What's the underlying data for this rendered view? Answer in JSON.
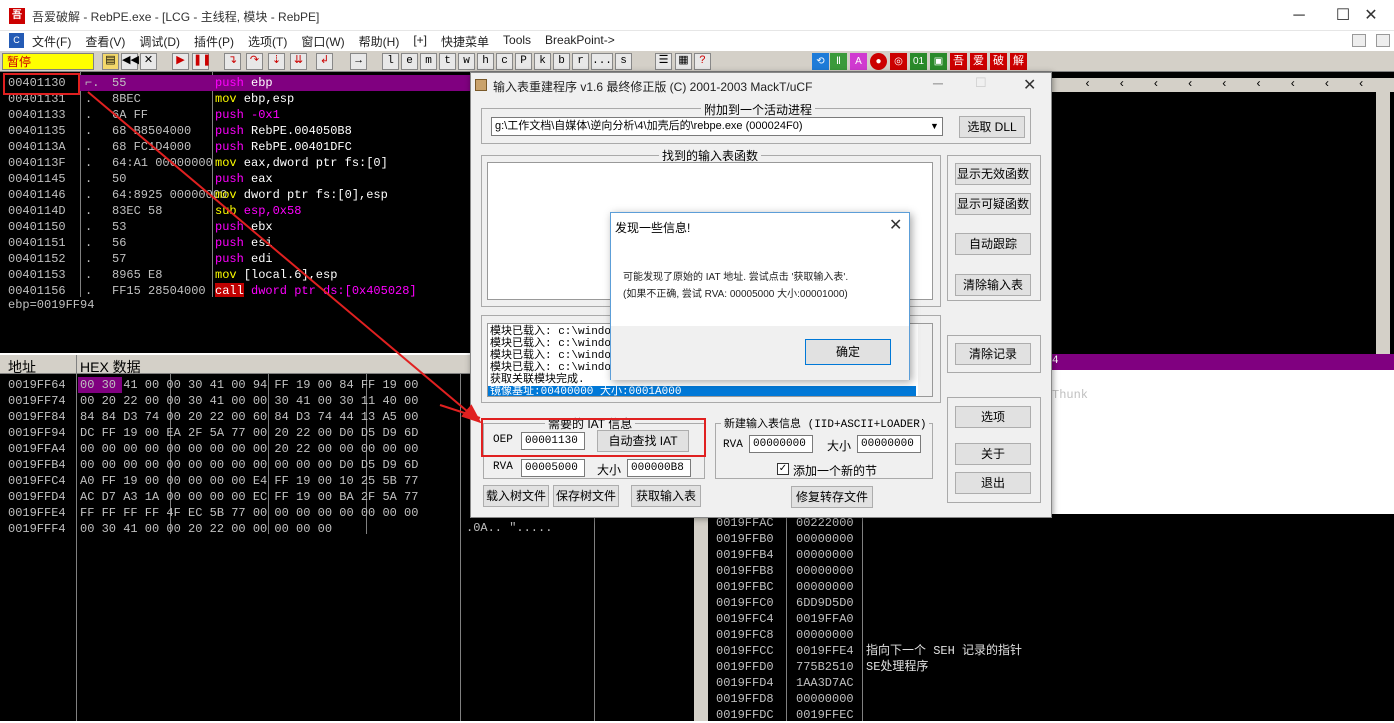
{
  "window": {
    "app_icon": "吾",
    "title": "吾爱破解 - RebPE.exe - [LCG -  主线程, 模块 - RebPE]",
    "min": "─",
    "max": "☐",
    "close": "✕"
  },
  "menu": {
    "icon": "C",
    "items": [
      "文件(F)",
      "查看(V)",
      "调试(D)",
      "插件(P)",
      "选项(T)",
      "窗口(W)",
      "帮助(H)",
      "[+]",
      "快捷菜单",
      "Tools",
      "BreakPoint->"
    ],
    "right_btns": [
      "▭",
      "▭"
    ]
  },
  "toolbar": {
    "status": "暂停",
    "letter_buttons": [
      "l",
      "e",
      "m",
      "t",
      "w",
      "h",
      "c",
      "P",
      "k",
      "b",
      "r",
      "...",
      "s"
    ],
    "right_buttons": [
      "吾",
      "爱",
      "破",
      "解"
    ]
  },
  "disasm": {
    "rows": [
      {
        "addr": "00401130",
        "dot": "⌐.",
        "hex": "55",
        "op": "push",
        "args": "ebp"
      },
      {
        "addr": "00401131",
        "dot": ".",
        "hex": "8BEC",
        "op": "mov",
        "args": "ebp,esp"
      },
      {
        "addr": "00401133",
        "dot": ".",
        "hex": "6A FF",
        "op": "push",
        "args": "-0x1"
      },
      {
        "addr": "00401135",
        "dot": ".",
        "hex": "68 B8504000",
        "op": "push",
        "args": "RebPE.004050B8"
      },
      {
        "addr": "0040113A",
        "dot": ".",
        "hex": "68 FC1D4000",
        "op": "push",
        "args": "RebPE.00401DFC"
      },
      {
        "addr": "0040113F",
        "dot": ".",
        "hex": "64:A1 00000000",
        "op": "mov",
        "args": "eax,dword ptr fs:[0]"
      },
      {
        "addr": "00401145",
        "dot": ".",
        "hex": "50",
        "op": "push",
        "args": "eax"
      },
      {
        "addr": "00401146",
        "dot": ".",
        "hex": "64:8925 00000000",
        "op": "mov",
        "args": "dword ptr fs:[0],esp"
      },
      {
        "addr": "0040114D",
        "dot": ".",
        "hex": "83EC 58",
        "op": "sub",
        "args": "esp,0x58"
      },
      {
        "addr": "00401150",
        "dot": ".",
        "hex": "53",
        "op": "push",
        "args": "ebx"
      },
      {
        "addr": "00401151",
        "dot": ".",
        "hex": "56",
        "op": "push",
        "args": "esi"
      },
      {
        "addr": "00401152",
        "dot": ".",
        "hex": "57",
        "op": "push",
        "args": "edi"
      },
      {
        "addr": "00401153",
        "dot": ".",
        "hex": "8965 E8",
        "op": "mov",
        "args": "[local.6],esp"
      },
      {
        "addr": "00401156",
        "dot": ".",
        "hex": "FF15 28504000",
        "op": "call",
        "args": "dword ptr ds:[0x405028]"
      }
    ],
    "reg_info": "ebp=0019FF94"
  },
  "dump": {
    "col_addr": "地址",
    "col_hex": "HEX 数据",
    "rows": [
      {
        "addr": "0019FF64",
        "hex": "00 30 41 00 00 30 41 00 94 FF 19 00 84 FF 19 00"
      },
      {
        "addr": "0019FF74",
        "hex": "00 20 22 00 00 30 41 00 00 30 41 00 30 11 40 00"
      },
      {
        "addr": "0019FF84",
        "hex": "84 84 D3 74 00 20 22 00 60 84 D3 74 44 13 A5 00"
      },
      {
        "addr": "0019FF94",
        "hex": "DC FF 19 00 EA 2F 5A 77 00 20 22 00 D0 D5 D9 6D"
      },
      {
        "addr": "0019FFA4",
        "hex": "00 00 00 00 00 00 00 00 00 20 22 00 00 00 00 00"
      },
      {
        "addr": "0019FFB4",
        "hex": "00 00 00 00 00 00 00 00 00 00 00 00 D0 D5 D9 6D"
      },
      {
        "addr": "0019FFC4",
        "hex": "A0 FF 19 00 00 00 00 00 E4 FF 19 00 10 25 5B 77"
      },
      {
        "addr": "0019FFD4",
        "hex": "AC D7 A3 1A 00 00 00 00 EC FF 19 00 BA 2F 5A 77"
      },
      {
        "addr": "0019FFE4",
        "hex": "FF FF FF FF 4F EC 5B 77 00 00 00 00 00 00 00 00"
      },
      {
        "addr": "0019FFF4",
        "hex": "00 30 41 00 00 20 22 00 00 00 00 00"
      }
    ],
    "ascii_last": ".0A..  \"....."
  },
  "stack": {
    "rows": [
      {
        "addr": "0019FFAC",
        "val": "00222000",
        "comment": ""
      },
      {
        "addr": "0019FFB0",
        "val": "00000000",
        "comment": ""
      },
      {
        "addr": "0019FFB4",
        "val": "00000000",
        "comment": ""
      },
      {
        "addr": "0019FFB8",
        "val": "00000000",
        "comment": ""
      },
      {
        "addr": "0019FFBC",
        "val": "00000000",
        "comment": ""
      },
      {
        "addr": "0019FFC0",
        "val": "6DD9D5D0",
        "comment": ""
      },
      {
        "addr": "0019FFC4",
        "val": "0019FFA0",
        "comment": ""
      },
      {
        "addr": "0019FFC8",
        "val": "00000000",
        "comment": ""
      },
      {
        "addr": "0019FFCC",
        "val": "0019FFE4",
        "comment": "指向下一个 SEH 记录的指针"
      },
      {
        "addr": "0019FFD0",
        "val": "775B2510",
        "comment": "SE处理程序"
      },
      {
        "addr": "0019FFD4",
        "val": "1AA3D7AC",
        "comment": ""
      },
      {
        "addr": "0019FFD8",
        "val": "00000000",
        "comment": ""
      },
      {
        "addr": "0019FFDC",
        "val": "0019FFEC",
        "comment": ""
      }
    ],
    "thunk": "Thunk",
    "header_char": "4"
  },
  "importrec": {
    "title": "输入表重建程序 v1.6 最终修正版 (C) 2001-2003 MackT/uCF",
    "attach_group": "附加到一个活动进程",
    "process": "g:\\工作文档\\自媒体\\逆向分析\\4\\加壳后的\\rebpe.exe (000024F0)",
    "pick_dll": "选取 DLL",
    "found_group": "找到的输入表函数",
    "btn_show_invalid": "显示无效函数",
    "btn_show_suspect": "显示可疑函数",
    "btn_auto_trace": "自动跟踪",
    "btn_clear_imports": "清除输入表",
    "btn_clear_log": "清除记录",
    "log_lines": [
      "模块已载入: c:\\windo",
      "模块已载入: c:\\windo",
      "模块已载入: c:\\windo",
      "模块已载入: c:\\windo",
      "获取关联模块完成."
    ],
    "log_selected": "镜像基址:00400000 大小:0001A000",
    "iat_group": "需要的 IAT 信息",
    "oep_label": "OEP",
    "oep_value": "00001130",
    "btn_auto_iat": "自动查找 IAT",
    "rva_label": "RVA",
    "rva_value": "00005000",
    "size_label": "大小",
    "size_value": "000000B8",
    "new_group": "新建输入表信息 (IID+ASCII+LOADER)",
    "new_rva_label": "RVA",
    "new_rva_value": "00000000",
    "new_size_label": "大小",
    "new_size_value": "00000000",
    "add_section": "添加一个新的节",
    "btn_load_tree": "载入树文件",
    "btn_save_tree": "保存树文件",
    "btn_get_imports": "获取输入表",
    "btn_fix_dump": "修复转存文件",
    "btn_options": "选项",
    "btn_about": "关于",
    "btn_exit": "退出"
  },
  "msgbox": {
    "title": "发现一些信息!",
    "line1": "可能发现了原始的 IAT 地址. 尝试点击 '获取输入表'.",
    "line2": "(如果不正确, 尝试 RVA: 00005000 大小:00001000)",
    "ok": "确定"
  },
  "colors": {
    "accent_red": "#e02020",
    "push_color": "#ff00ff",
    "mov_color": "#ffff00",
    "highlight_purple": "#800080"
  }
}
